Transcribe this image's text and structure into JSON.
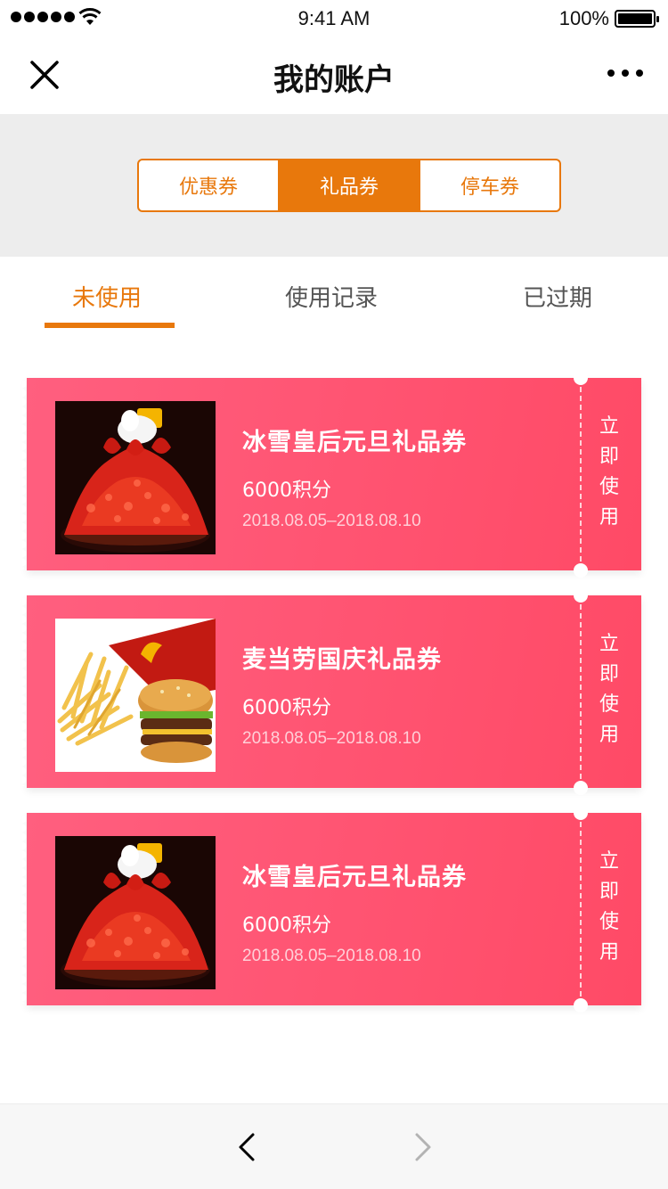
{
  "status_bar": {
    "time": "9:41 AM",
    "battery": "100%"
  },
  "nav": {
    "title": "我的账户"
  },
  "segments": [
    {
      "label": "优惠券",
      "active": false
    },
    {
      "label": "礼品券",
      "active": true
    },
    {
      "label": "停车券",
      "active": false
    }
  ],
  "tabs": [
    {
      "label": "未使用",
      "active": true
    },
    {
      "label": "使用记录",
      "active": false
    },
    {
      "label": "已过期",
      "active": false
    }
  ],
  "coupons": [
    {
      "title": "冰雪皇后元旦礼品券",
      "points": "6000积分",
      "date": "2018.08.05–2018.08.10",
      "image": "strawberry-dessert",
      "action": "立即使用"
    },
    {
      "title": "麦当劳国庆礼品券",
      "points": "6000积分",
      "date": "2018.08.05–2018.08.10",
      "image": "burger-fries",
      "action": "立即使用"
    },
    {
      "title": "冰雪皇后元旦礼品券",
      "points": "6000积分",
      "date": "2018.08.05–2018.08.10",
      "image": "strawberry-dessert",
      "action": "立即使用"
    }
  ],
  "colors": {
    "accent": "#e8780c",
    "coupon": "#ff5371"
  }
}
